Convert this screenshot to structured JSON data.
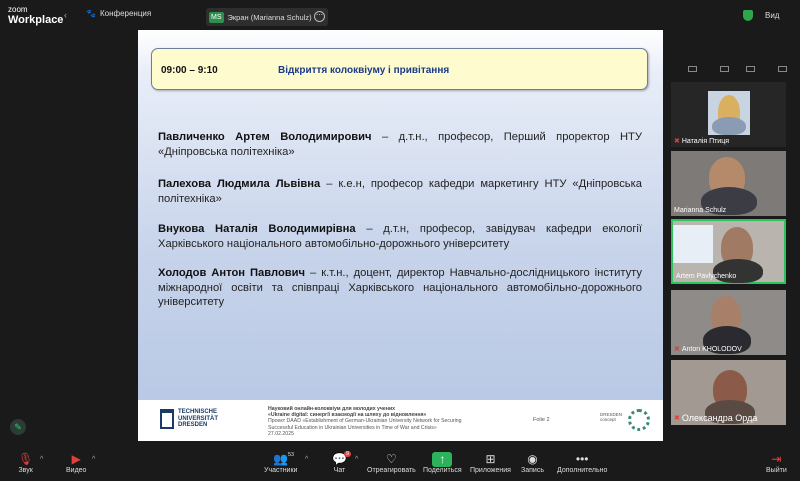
{
  "app": {
    "logo_top": "zoom",
    "logo_bottom": "Workplace",
    "meeting_label": "Конференция"
  },
  "screen_share": {
    "initials": "MS",
    "label": "Экран (Marianna Schulz)"
  },
  "view_label": "Вид",
  "slide": {
    "banner_time": "09:00 – 9:10",
    "banner_title": "Відкриття колоквіуму і привітання",
    "speakers": [
      {
        "name": "Павличенко Артем Володимирович",
        "details": " – д.т.н., професор, Перший проректор НТУ «Дніпровська політехніка»"
      },
      {
        "name": "Палехова Людмила Львівна",
        "details": " – к.е.н, професор кафедри маркетингу НТУ «Дніпровська політехніка»"
      },
      {
        "name": "Внукова Наталія Володимирівна",
        "details": " – д.т.н, професор, завідувач кафедри екології Харківського національного автомобільно-дорожнього університету"
      },
      {
        "name": "Холодов Антон Павлович",
        "details": " – к.т.н., доцент, директор Навчально-дослідницького інституту міжнародної освіти та співпраці Харківського національного автомобільно-дорожнього університету"
      }
    ],
    "footer": {
      "tud_line1": "TECHNISCHE",
      "tud_line2": "UNIVERSITÄT",
      "tud_line3": "DRESDEN",
      "line1": "Науковий онлайн-колоквіум для молодих учених",
      "line2": "«Ukraine digital: синергії взаємодії на шляху до відновлення»",
      "line3": "Проект DAAD «Establishment of German-Ukrainian University Network for Securing",
      "line4": "Successful Education in Ukrainian Universities in Time of War and Crisis»",
      "line5": "27.02.2025",
      "page": "Folie 2",
      "dresden1": "DRESDEN",
      "dresden2": "concept"
    }
  },
  "participants": [
    {
      "name": "Наталія Птиця",
      "muted": true
    },
    {
      "name": "Marianna Schulz",
      "muted": false
    },
    {
      "name": "Artem Pavlychenko",
      "muted": false,
      "active": true
    },
    {
      "name": "Anton KHOLODOV",
      "muted": true
    },
    {
      "name": "Олександра Орда",
      "muted": true
    }
  ],
  "toolbar": {
    "audio": "Звук",
    "video": "Видео",
    "participants": "Участники",
    "participants_count": "53",
    "chat": "Чат",
    "chat_badge": "9",
    "react": "Отреагировать",
    "share": "Поделиться",
    "apps": "Приложения",
    "record": "Запись",
    "more": "Дополнительно",
    "leave": "Выйти"
  }
}
